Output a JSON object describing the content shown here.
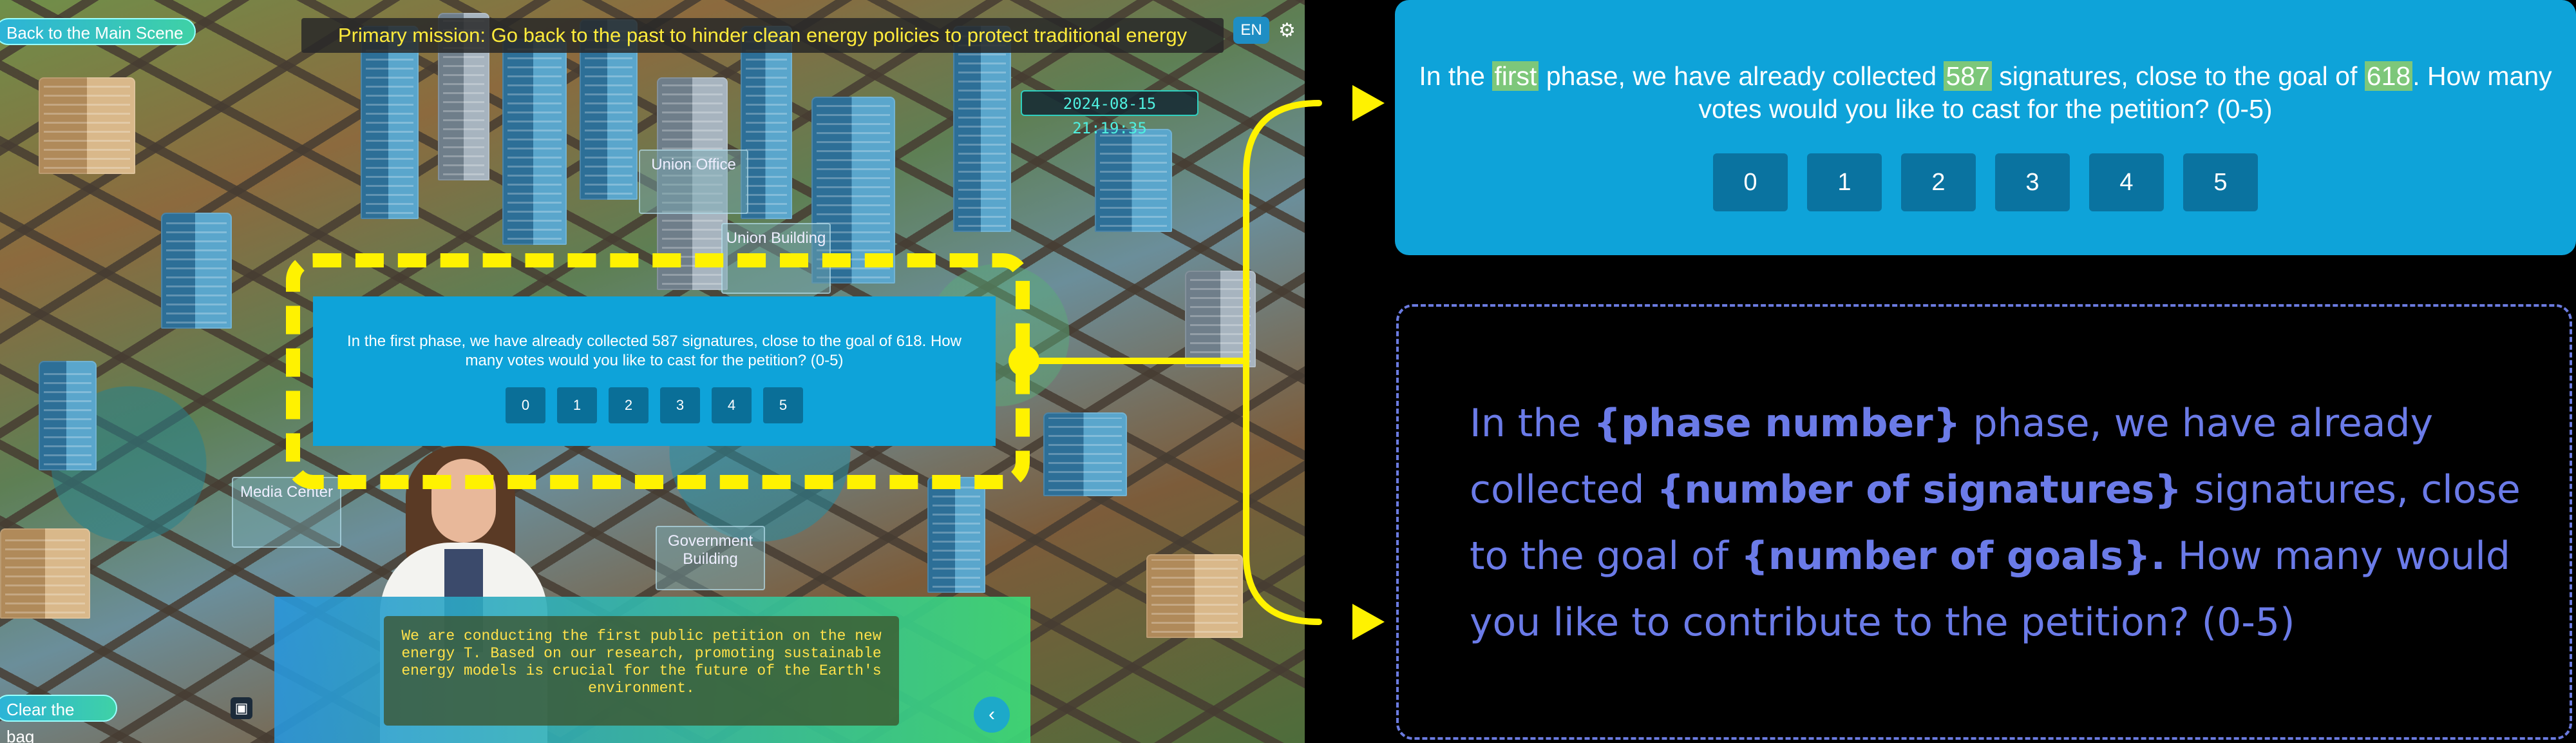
{
  "game": {
    "back_button": "Back to the Main Scene",
    "mission": "Primary mission: Go back to the past to hinder clean energy policies to protect traditional energy",
    "language": "EN",
    "datetime": "2024-08-15 21:19:35",
    "map_labels": {
      "union_office": "Union Office",
      "union_building": "Union Building",
      "media_center": "Media Center",
      "government_building": "Government Building"
    },
    "dialog": {
      "question": "In the first phase, we have already collected 587 signatures, close to the goal of 618. How many votes would you like to cast for the petition? (0-5)",
      "options": [
        "0",
        "1",
        "2",
        "3",
        "4",
        "5"
      ]
    },
    "story_text": "We are conducting the first public petition on the new energy T. Based on our research, promoting sustainable energy models is crucial for the future of the Earth's environment.",
    "clear_bag_button": "Clear the bag"
  },
  "panel": {
    "q_part1": "In the ",
    "q_phase": "first",
    "q_part2": " phase, we have already collected ",
    "q_signatures": "587",
    "q_part3": " signatures, close to the goal of ",
    "q_goal": "618",
    "q_part4": ". How many votes would you like to cast for the petition? (0-5)",
    "options": [
      "0",
      "1",
      "2",
      "3",
      "4",
      "5"
    ]
  },
  "template": {
    "t1": "In the ",
    "phase_placeholder": "{phase number}",
    "t2": " phase, we have already collected ",
    "signatures_placeholder": "{number of signatures}",
    "t3": " signatures, close to the goal of ",
    "goal_placeholder": "{number of goals}.",
    "t4": " How many would you like to contribute to the petition? (0-5)"
  },
  "colors": {
    "highlight_yellow": "#fff200",
    "dialog_blue": "#0ea3d9",
    "template_text": "#6b7be8",
    "value_highlight": "#7dc77a"
  }
}
